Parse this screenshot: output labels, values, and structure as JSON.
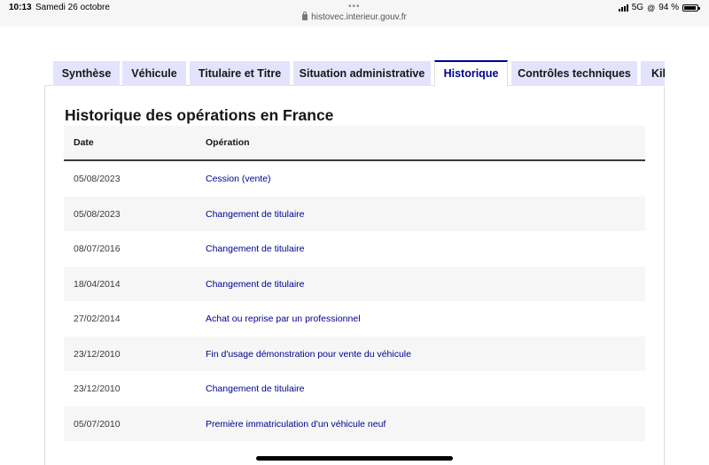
{
  "status_bar": {
    "time": "10:13",
    "date": "Samedi 26 octobre",
    "multitask_dots": "•••",
    "url": "histovec.interieur.gouv.fr",
    "network": "5G",
    "battery": "94 %",
    "battery_level": 0.94
  },
  "tabs": [
    {
      "label": "Synthèse"
    },
    {
      "label": "Véhicule"
    },
    {
      "label": "Titulaire et Titre"
    },
    {
      "label": "Situation administrative"
    },
    {
      "label": "Historique"
    },
    {
      "label": "Contrôles techniques"
    },
    {
      "label": "Kilométrage"
    }
  ],
  "active_tab": "Historique",
  "section": {
    "title": "Historique des opérations en France"
  },
  "table": {
    "headers": {
      "date": "Date",
      "operation": "Opération"
    },
    "rows": [
      {
        "date": "05/08/2023",
        "operation": "Cession (vente)"
      },
      {
        "date": "05/08/2023",
        "operation": "Changement de titulaire"
      },
      {
        "date": "08/07/2016",
        "operation": "Changement de titulaire"
      },
      {
        "date": "18/04/2014",
        "operation": "Changement de titulaire"
      },
      {
        "date": "27/02/2014",
        "operation": "Achat ou reprise par un professionnel"
      },
      {
        "date": "23/12/2010",
        "operation": "Fin d'usage démonstration pour vente du véhicule"
      },
      {
        "date": "23/12/2010",
        "operation": "Changement de titulaire"
      },
      {
        "date": "05/07/2010",
        "operation": "Première immatriculation d'un véhicule neuf"
      }
    ]
  },
  "colors": {
    "accent": "#000091",
    "tab_bg": "#e3e3fd",
    "row_alt": "#f6f6f6"
  }
}
